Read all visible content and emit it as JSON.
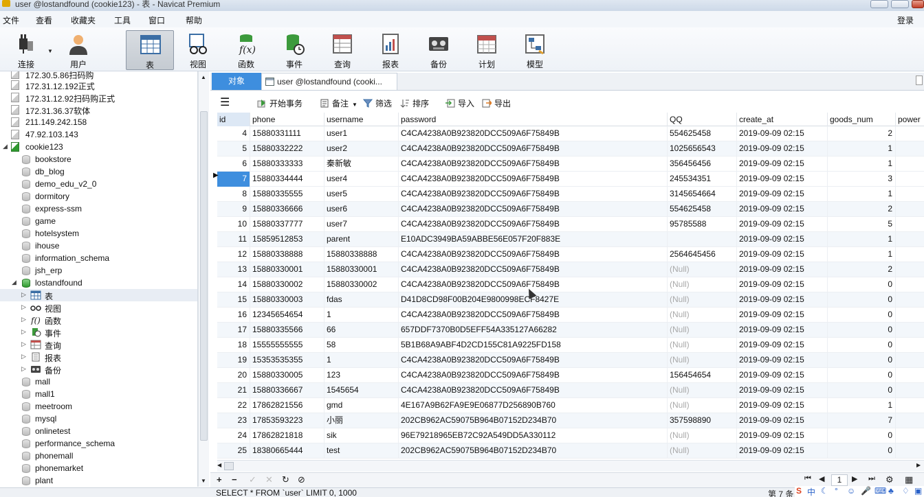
{
  "window": {
    "title": "user @lostandfound (cookie123) - 表 - Navicat Premium"
  },
  "menu": {
    "items": [
      "文件",
      "查看",
      "收藏夹",
      "工具",
      "窗口",
      "帮助"
    ],
    "login": "登录"
  },
  "toolbar": {
    "buttons": [
      {
        "label": "连接",
        "icon": "connect-icon"
      },
      {
        "label": "用户",
        "icon": "user-icon"
      },
      {
        "label": "表",
        "icon": "table-icon"
      },
      {
        "label": "视图",
        "icon": "view-icon"
      },
      {
        "label": "函数",
        "icon": "function-icon"
      },
      {
        "label": "事件",
        "icon": "event-icon"
      },
      {
        "label": "查询",
        "icon": "query-icon"
      },
      {
        "label": "报表",
        "icon": "report-icon"
      },
      {
        "label": "备份",
        "icon": "backup-icon"
      },
      {
        "label": "计划",
        "icon": "schedule-icon"
      },
      {
        "label": "模型",
        "icon": "model-icon"
      }
    ],
    "active": "表"
  },
  "tree": {
    "hosts": [
      "172.30.5.86扫码购",
      "172.31.12.192正式",
      "172.31.12.92扫码购正式",
      "172.31.36.37软体",
      "211.149.242.158",
      "47.92.103.143"
    ],
    "connection": "cookie123",
    "databases_before": [
      "bookstore",
      "db_blog",
      "demo_edu_v2_0",
      "dormitory",
      "express-ssm",
      "game",
      "hotelsystem",
      "ihouse",
      "information_schema",
      "jsh_erp"
    ],
    "open_db": "lostandfound",
    "open_db_children": [
      "表",
      "视图",
      "函数",
      "事件",
      "查询",
      "报表",
      "备份"
    ],
    "databases_after": [
      "mall",
      "mall1",
      "meetroom",
      "mysql",
      "onlinetest",
      "performance_schema",
      "phonemall",
      "phonemarket",
      "plant"
    ]
  },
  "tabs": {
    "objects": "对象",
    "table_tab": "user @lostandfound (cooki..."
  },
  "actions": {
    "menu": "menu-icon",
    "begin_transaction": "开始事务",
    "memo": "备注",
    "filter": "筛选",
    "sort": "排序",
    "import": "导入",
    "export": "导出"
  },
  "grid": {
    "columns": [
      "id",
      "phone",
      "username",
      "password",
      "QQ",
      "create_at",
      "goods_num",
      "power"
    ],
    "current_row_id": "7",
    "rows": [
      [
        "4",
        "15880331111",
        "user1",
        "C4CA4238A0B923820DCC509A6F75849B",
        "554625458",
        "2019-09-09 02:15",
        "2"
      ],
      [
        "5",
        "15880332222",
        "user2",
        "C4CA4238A0B923820DCC509A6F75849B",
        "1025656543",
        "2019-09-09 02:15",
        "1"
      ],
      [
        "6",
        "15880333333",
        "秦新敏",
        "C4CA4238A0B923820DCC509A6F75849B",
        "356456456",
        "2019-09-09 02:15",
        "1"
      ],
      [
        "7",
        "15880334444",
        "user4",
        "C4CA4238A0B923820DCC509A6F75849B",
        "245534351",
        "2019-09-09 02:15",
        "3"
      ],
      [
        "8",
        "15880335555",
        "user5",
        "C4CA4238A0B923820DCC509A6F75849B",
        "3145654664",
        "2019-09-09 02:15",
        "1"
      ],
      [
        "9",
        "15880336666",
        "user6",
        "C4CA4238A0B923820DCC509A6F75849B",
        "554625458",
        "2019-09-09 02:15",
        "2"
      ],
      [
        "10",
        "15880337777",
        "user7",
        "C4CA4238A0B923820DCC509A6F75849B",
        "95785588",
        "2019-09-09 02:15",
        "5"
      ],
      [
        "11",
        "15859512853",
        "parent",
        "E10ADC3949BA59ABBE56E057F20F883E",
        "",
        "2019-09-09 02:15",
        "1"
      ],
      [
        "12",
        "15880338888",
        "15880338888",
        "C4CA4238A0B923820DCC509A6F75849B",
        "2564645456",
        "2019-09-09 02:15",
        "1"
      ],
      [
        "13",
        "15880330001",
        "15880330001",
        "C4CA4238A0B923820DCC509A6F75849B",
        "(Null)",
        "2019-09-09 02:15",
        "2"
      ],
      [
        "14",
        "15880330002",
        "15880330002",
        "C4CA4238A0B923820DCC509A6F75849B",
        "(Null)",
        "2019-09-09 02:15",
        "0"
      ],
      [
        "15",
        "15880330003",
        "fdas",
        "D41D8CD98F00B204E9800998ECF8427E",
        "(Null)",
        "2019-09-09 02:15",
        "0"
      ],
      [
        "16",
        "12345654654",
        "1",
        "C4CA4238A0B923820DCC509A6F75849B",
        "(Null)",
        "2019-09-09 02:15",
        "0"
      ],
      [
        "17",
        "15880335566",
        "66",
        "657DDF7370B0D5EFF54A335127A66282",
        "(Null)",
        "2019-09-09 02:15",
        "0"
      ],
      [
        "18",
        "15555555555",
        "58",
        "5B1B68A9ABF4D2CD155C81A9225FD158",
        "(Null)",
        "2019-09-09 02:15",
        "0"
      ],
      [
        "19",
        "15353535355",
        "1",
        "C4CA4238A0B923820DCC509A6F75849B",
        "(Null)",
        "2019-09-09 02:15",
        "0"
      ],
      [
        "20",
        "15880330005",
        "123",
        "C4CA4238A0B923820DCC509A6F75849B",
        "156454654",
        "2019-09-09 02:15",
        "0"
      ],
      [
        "21",
        "15880336667",
        "1545654",
        "C4CA4238A0B923820DCC509A6F75849B",
        "(Null)",
        "2019-09-09 02:15",
        "0"
      ],
      [
        "22",
        "17862821556",
        "gmd",
        "4E167A9B62FA9E9E06877D256890B760",
        "(Null)",
        "2019-09-09 02:15",
        "1"
      ],
      [
        "23",
        "17853593223",
        "小丽",
        "202CB962AC59075B964B07152D234B70",
        "357598890",
        "2019-09-09 02:15",
        "7"
      ],
      [
        "24",
        "17862821818",
        "sik",
        "96E79218965EB72C92A549DD5A330112",
        "(Null)",
        "2019-09-09 02:15",
        "0"
      ],
      [
        "25",
        "18380665444",
        "test",
        "202CB962AC59075B964B07152D234B70",
        "(Null)",
        "2019-09-09 02:15",
        "0"
      ]
    ]
  },
  "bottom": {
    "page": "1"
  },
  "status": {
    "sql": "SELECT * FROM `user` LIMIT 0, 1000",
    "records": "第 7 条"
  },
  "ime": {
    "label": "中"
  },
  "colors": {
    "accent": "#3e8ede",
    "null_text": "#a8a8a8"
  }
}
